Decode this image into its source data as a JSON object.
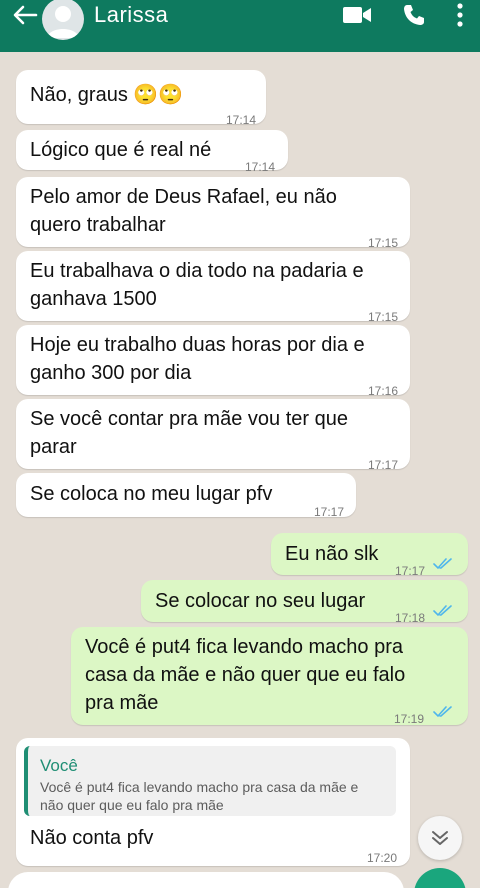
{
  "header": {
    "contact_name": "Larissa",
    "colors": {
      "bar": "#0e7a5f",
      "icons": "#ffffff"
    },
    "icons": [
      "back-arrow-icon",
      "video-call-icon",
      "phone-icon",
      "more-options-icon"
    ]
  },
  "messages": [
    {
      "direction": "incoming",
      "text": "Não, graus 🙄🙄",
      "time": "17:14"
    },
    {
      "direction": "incoming",
      "text": "Lógico que é real né",
      "time": "17:14"
    },
    {
      "direction": "incoming",
      "text": "Pelo amor de Deus Rafael, eu não\nquero trabalhar",
      "time": "17:15"
    },
    {
      "direction": "incoming",
      "text": "Eu trabalhava o dia todo na padaria e\nganhava 1500",
      "time": "17:15"
    },
    {
      "direction": "incoming",
      "text": "Hoje eu trabalho duas horas por dia e\nganho 300 por dia",
      "time": "17:16"
    },
    {
      "direction": "incoming",
      "text": "Se você contar pra mãe vou ter que\nparar",
      "time": "17:17"
    },
    {
      "direction": "incoming",
      "text": "Se coloca no meu lugar pfv",
      "time": "17:17"
    },
    {
      "direction": "outgoing",
      "text": "Eu não slk",
      "time": "17:17",
      "status": "read"
    },
    {
      "direction": "outgoing",
      "text": "Se colocar no seu lugar",
      "time": "17:18",
      "status": "read"
    },
    {
      "direction": "outgoing",
      "text": "Você é put4 fica levando macho pra\ncasa da mãe e não quer que eu falo\npra mãe",
      "time": "17:19",
      "status": "read"
    },
    {
      "direction": "incoming",
      "reply_to": {
        "author": "Você",
        "text": "Você é put4 fica levando macho pra casa da mãe e\nnão quer que eu falo pra mãe"
      },
      "text": "Não conta pfv",
      "time": "17:20"
    }
  ],
  "colors": {
    "wallpaper": "#e4ddd5",
    "incoming_bubble": "#ffffff",
    "outgoing_bubble": "#dcf7c5",
    "read_ticks": "#4fb6ec",
    "quote_accent": "#1f8e74"
  },
  "scroll_button": {
    "icon": "double-chevron-down-icon"
  }
}
